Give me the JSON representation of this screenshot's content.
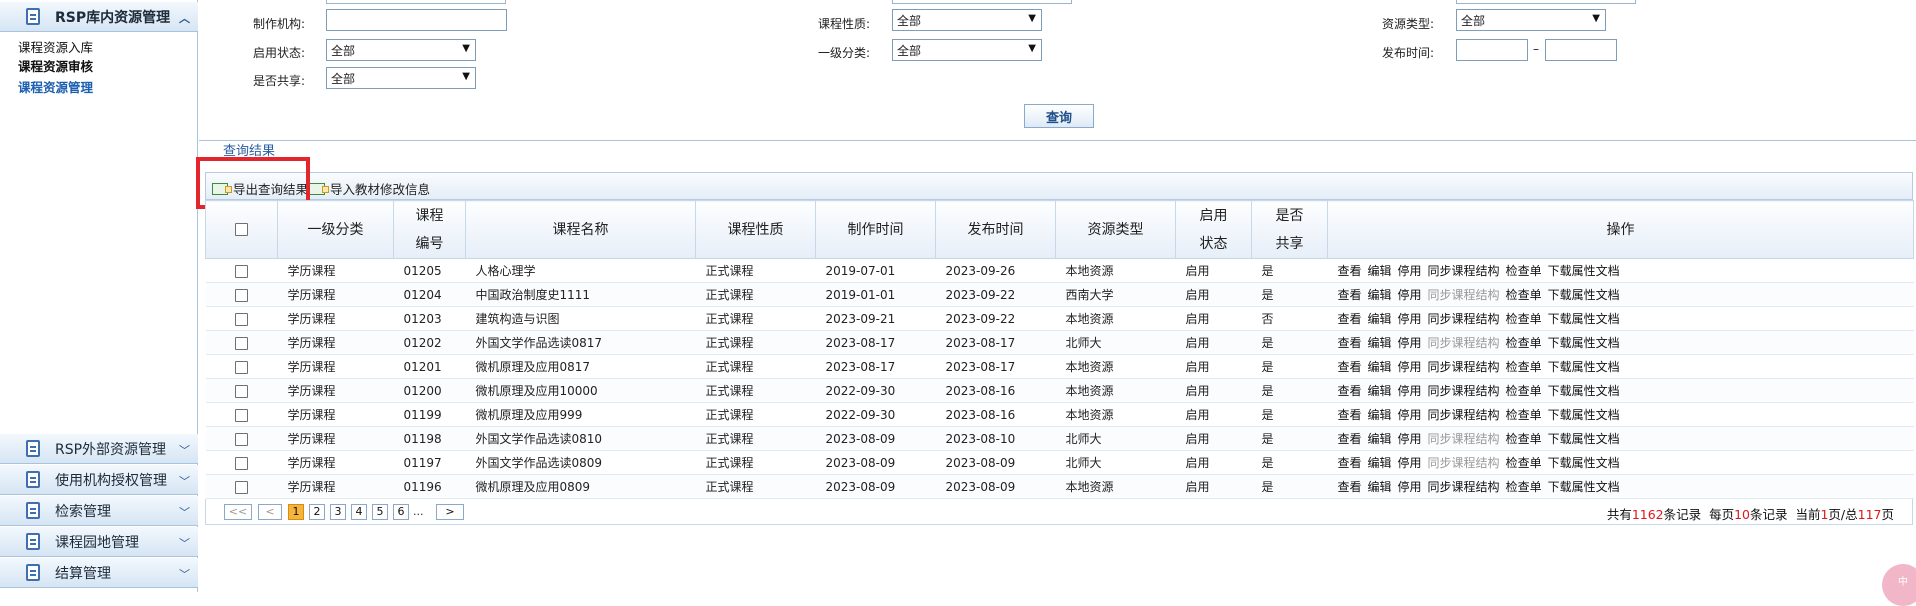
{
  "sidebar": {
    "active_menu": "RSP库内资源管理",
    "sub_items": [
      "课程资源入库",
      "课程资源审核",
      "课程资源管理"
    ],
    "menus": [
      "RSP外部资源管理",
      "使用机构授权管理",
      "检索管理",
      "课程园地管理",
      "结算管理"
    ]
  },
  "filters": {
    "producer_label": "制作机构:",
    "enable_label": "启用状态:",
    "enable_value": "全部",
    "shared_label": "是否共享:",
    "shared_value": "全部",
    "course_type_label": "课程性质:",
    "course_type_value": "全部",
    "category_label": "一级分类:",
    "category_value": "全部",
    "resource_type_label": "资源类型:",
    "resource_type_value": "全部",
    "publish_label": "发布时间:",
    "date_sep": "–",
    "query_button": "查询"
  },
  "results": {
    "title": "查询结果",
    "export_label": "导出查询结果",
    "import_label": "导入教材修改信息"
  },
  "table": {
    "headers": [
      "一级分类",
      "课程\n编号",
      "课程名称",
      "课程性质",
      "制作时间",
      "发布时间",
      "资源类型",
      "启用\n状态",
      "是否\n共享",
      "操作"
    ],
    "ops": [
      "查看",
      "编辑",
      "停用",
      "同步课程结构",
      "检查单",
      "下载属性文档"
    ],
    "rows": [
      {
        "cat": "学历课程",
        "code": "01205",
        "name": "人格心理学",
        "nature": "正式课程",
        "made": "2019-07-01",
        "pub": "2023-09-26",
        "rtype": "本地资源",
        "status": "启用",
        "shared": "是",
        "sync_disabled": false
      },
      {
        "cat": "学历课程",
        "code": "01204",
        "name": "中国政治制度史1111",
        "nature": "正式课程",
        "made": "2019-01-01",
        "pub": "2023-09-22",
        "rtype": "西南大学",
        "status": "启用",
        "shared": "是",
        "sync_disabled": true
      },
      {
        "cat": "学历课程",
        "code": "01203",
        "name": "建筑构造与识图",
        "nature": "正式课程",
        "made": "2023-09-21",
        "pub": "2023-09-22",
        "rtype": "本地资源",
        "status": "启用",
        "shared": "否",
        "sync_disabled": false
      },
      {
        "cat": "学历课程",
        "code": "01202",
        "name": "外国文学作品选读0817",
        "nature": "正式课程",
        "made": "2023-08-17",
        "pub": "2023-08-17",
        "rtype": "北师大",
        "status": "启用",
        "shared": "是",
        "sync_disabled": true
      },
      {
        "cat": "学历课程",
        "code": "01201",
        "name": "微机原理及应用0817",
        "nature": "正式课程",
        "made": "2023-08-17",
        "pub": "2023-08-17",
        "rtype": "本地资源",
        "status": "启用",
        "shared": "是",
        "sync_disabled": false
      },
      {
        "cat": "学历课程",
        "code": "01200",
        "name": "微机原理及应用10000",
        "nature": "正式课程",
        "made": "2022-09-30",
        "pub": "2023-08-16",
        "rtype": "本地资源",
        "status": "启用",
        "shared": "是",
        "sync_disabled": false
      },
      {
        "cat": "学历课程",
        "code": "01199",
        "name": "微机原理及应用999",
        "nature": "正式课程",
        "made": "2022-09-30",
        "pub": "2023-08-16",
        "rtype": "本地资源",
        "status": "启用",
        "shared": "是",
        "sync_disabled": false
      },
      {
        "cat": "学历课程",
        "code": "01198",
        "name": "外国文学作品选读0810",
        "nature": "正式课程",
        "made": "2023-08-09",
        "pub": "2023-08-10",
        "rtype": "北师大",
        "status": "启用",
        "shared": "是",
        "sync_disabled": true
      },
      {
        "cat": "学历课程",
        "code": "01197",
        "name": "外国文学作品选读0809",
        "nature": "正式课程",
        "made": "2023-08-09",
        "pub": "2023-08-09",
        "rtype": "北师大",
        "status": "启用",
        "shared": "是",
        "sync_disabled": true
      },
      {
        "cat": "学历课程",
        "code": "01196",
        "name": "微机原理及应用0809",
        "nature": "正式课程",
        "made": "2023-08-09",
        "pub": "2023-08-09",
        "rtype": "本地资源",
        "status": "启用",
        "shared": "是",
        "sync_disabled": false
      }
    ]
  },
  "pager": {
    "pages": [
      "1",
      "2",
      "3",
      "4",
      "5",
      "6"
    ],
    "ellipsis": "...",
    "current": "1",
    "info_prefix": "共有",
    "total_records": "1162",
    "info_mid1": "条记录  每页",
    "per_page": "10",
    "info_mid2": "条记录  当前",
    "cur_page": "1",
    "info_mid3": "页/总",
    "total_pages": "117",
    "info_suffix": "页"
  },
  "corner_badge": "中",
  "colors": {
    "accent": "#1d5fb0",
    "highlight_box": "#e3262d",
    "current_page": "#f6b53a"
  }
}
